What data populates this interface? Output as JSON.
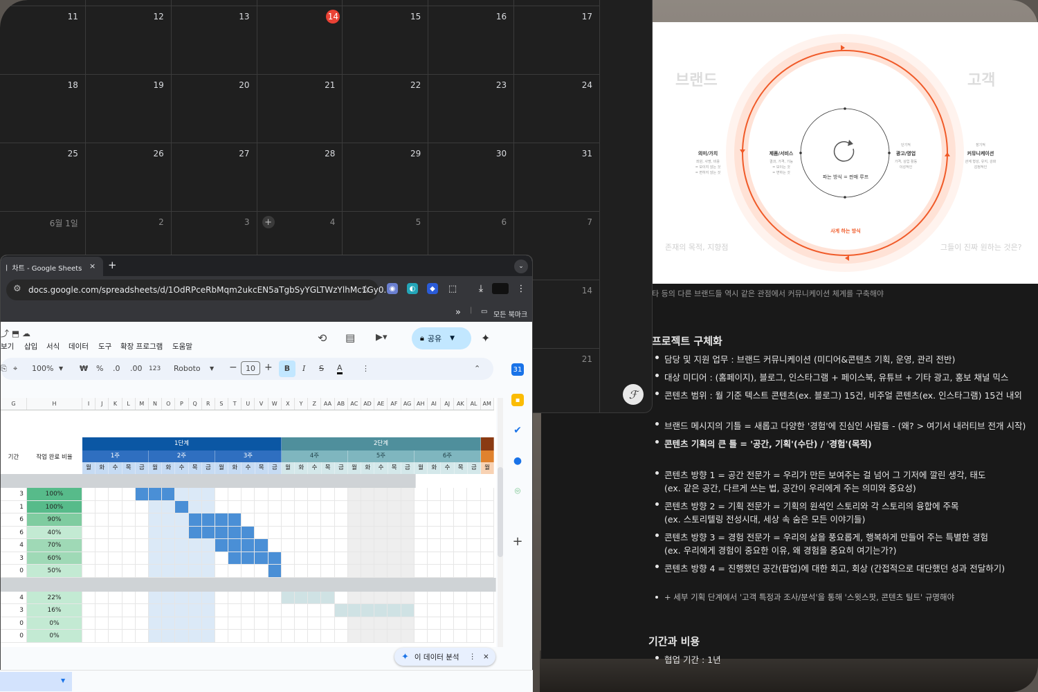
{
  "calendar": {
    "weeks": [
      [
        {
          "n": "",
          "dim": false
        },
        {
          "n": "",
          "dim": false
        },
        {
          "n": "",
          "dim": false
        },
        {
          "n": "",
          "dim": false
        },
        {
          "n": "",
          "dim": false
        },
        {
          "n": "",
          "dim": false
        },
        {
          "n": "",
          "dim": false
        }
      ],
      [
        {
          "n": "11"
        },
        {
          "n": "12"
        },
        {
          "n": "13"
        },
        {
          "n": "14",
          "today": true
        },
        {
          "n": "15"
        },
        {
          "n": "16"
        },
        {
          "n": "17"
        }
      ],
      [
        {
          "n": "18"
        },
        {
          "n": "19"
        },
        {
          "n": "20"
        },
        {
          "n": "21"
        },
        {
          "n": "22"
        },
        {
          "n": "23"
        },
        {
          "n": "24"
        }
      ],
      [
        {
          "n": "25"
        },
        {
          "n": "26"
        },
        {
          "n": "27"
        },
        {
          "n": "28"
        },
        {
          "n": "29"
        },
        {
          "n": "30"
        },
        {
          "n": "31"
        }
      ],
      [
        {
          "n": "6월 1일",
          "dim": true
        },
        {
          "n": "2",
          "dim": true
        },
        {
          "n": "3",
          "dim": true
        },
        {
          "n": "4",
          "dim": true,
          "add": true
        },
        {
          "n": "5",
          "dim": true
        },
        {
          "n": "6",
          "dim": true
        },
        {
          "n": "7",
          "dim": true
        }
      ],
      [
        {
          "n": "",
          "dim": true
        },
        {
          "n": "",
          "dim": true
        },
        {
          "n": "",
          "dim": true
        },
        {
          "n": "",
          "dim": true
        },
        {
          "n": "",
          "dim": true
        },
        {
          "n": "",
          "dim": true
        },
        {
          "n": "14",
          "dim": true
        }
      ],
      [
        {
          "n": "",
          "dim": true
        },
        {
          "n": "",
          "dim": true
        },
        {
          "n": "",
          "dim": true
        },
        {
          "n": "",
          "dim": true
        },
        {
          "n": "",
          "dim": true
        },
        {
          "n": "",
          "dim": true
        },
        {
          "n": "21",
          "dim": true
        }
      ]
    ],
    "add_symbol": "+"
  },
  "slide": {
    "brand": "브랜드",
    "customer": "고객",
    "brand_sub": "존재의 목적, 지향점",
    "customer_sub": "그들이 진짜 원하는 것은?",
    "center": "파는 방식 = 판매 루프",
    "bottom": "사게 하는 방식",
    "n1": {
      "title": "의미/가치",
      "sub": "좌원, 사명, 비용\n= 보이지 않는 것\n= 변하지 않는 것"
    },
    "n2": {
      "title": "제품/서비스",
      "sub": "결과, 가격, 기능\n= 보이는 것\n= 변하는 것"
    },
    "n3": {
      "top": "단기적",
      "title": "광고/영업",
      "sub": "가격, 상업 활동\n이성적인"
    },
    "n4": {
      "top": "장기적",
      "title": "커뮤니케이션",
      "sub": "관계 형성, 유지, 강화\n감정적인"
    },
    "accent": "#f05a28"
  },
  "doc": {
    "caption": "타 등의 다른 브랜드들 역시 같은 관점에서 커뮤니케이션 체계를 구축해야",
    "section1": "프로젝트 구체화",
    "b1": "담당 및 지원 업무 :              브랜드 커뮤니케이션 (미디어&콘텐츠 기획, 운영, 관리 전반)",
    "b2": "대상 미디어 : (홈페이지), 블로그, 인스타그램 + 페이스북, 유튜브 + 기타 광고, 홍보 채널 믹스",
    "b3": "콘텐츠 범위 : 월 기준 텍스트 콘텐츠(ex. 블로그) 15건, 비주얼 콘텐츠(ex. 인스타그램) 15건 내외",
    "b4": "브랜드 메시지의 기틀 = 새롭고 다양한 '경험'에 진심인 사람들 - (왜? > 여기서 내러티브 전개 시작)",
    "b5": "콘텐츠 기획의 큰 틀 = '공간, 기획'(수단) / '경험'(목적)",
    "b6a": "콘텐츠 방향 1 = 공간 전문가 = 우리가 만든 보여주는 걸 넘어 그 기저에 깔린 생각, 태도",
    "b6b": "(ex. 같은 공간, 다르게 쓰는 법, 공간이 우리에게 주는 의미와 중요성)",
    "b7a": "콘텐츠 방향 2 = 기획 전문가 = 기획의 원석인 스토리와 각 스토리의 융합에 주목",
    "b7b": "(ex. 스토리텔링 전성시대, 세상 속 숨은 모든 이야기들)",
    "b8a": "콘텐츠 방향 3 = 경험 전문가 = 우리의 삶을 풍요롭게, 행복하게 만들어 주는 특별한 경험",
    "b8b": "(ex. 우리에게 경험이 중요한 이유, 왜 경험을 중요히 여기는가?)",
    "b9": "콘텐츠 방향 4 = 진행했던 공간(팝업)에 대한 회고, 회상 (간접적으로 대단했던 성과 전달하기)",
    "b10": "+ 세부 기획 단계에서 '고객 특정과 조사/분석'을 통해 '스윗스팟, 콘텐츠 틸트' 규명해야",
    "section2": "기간과 비용",
    "b11": "협업 기간 : 1년"
  },
  "browser": {
    "tab_title": "ㅣ 차트 - Google Sheets",
    "close": "×",
    "newtab": "+",
    "url": "docs.google.com/spreadsheets/d/1OdRPceRbMqm2ukcEN5aTgbSyYGLTWzYlhMc1Gy0...",
    "more_bookmarks": "»",
    "all_bookmarks": "모든 북마크"
  },
  "sheets": {
    "menus": [
      "보기",
      "삽입",
      "서식",
      "데이터",
      "도구",
      "확장 프로그램",
      "도움말"
    ],
    "share": "공유",
    "zoom": "100%",
    "currency": "₩",
    "percent": "%",
    "dec_less": ".0",
    "dec_more": ".00",
    "format123": "123",
    "font": "Roboto",
    "font_size": "10",
    "bold": "B",
    "italic": "I",
    "strike": "S",
    "textcolor": "A",
    "cols": [
      "G",
      "H",
      "I",
      "J",
      "K",
      "L",
      "M",
      "N",
      "O",
      "P",
      "Q",
      "R",
      "S",
      "T",
      "U",
      "V",
      "W",
      "X",
      "Y",
      "Z",
      "AA",
      "AB",
      "AC",
      "AD",
      "AE",
      "AF",
      "AG",
      "AH",
      "AI",
      "AJ",
      "AK",
      "AL",
      "AM"
    ],
    "phase1": "1단계",
    "phase2": "2단계",
    "weeks": [
      "1주",
      "2주",
      "3주",
      "4주",
      "5주",
      "6주"
    ],
    "days": [
      "월",
      "화",
      "수",
      "목",
      "금"
    ],
    "period_hdr": "기간",
    "ratio_hdr": "작업 완료 비율",
    "rows": [
      {
        "g": "3",
        "h": "100%"
      },
      {
        "g": "1",
        "h": "100%"
      },
      {
        "g": "6",
        "h": "90%"
      },
      {
        "g": "6",
        "h": "40%"
      },
      {
        "g": "4",
        "h": "70%"
      },
      {
        "g": "3",
        "h": "60%"
      },
      {
        "g": "0",
        "h": "50%"
      },
      {
        "g": "",
        "h": ""
      },
      {
        "g": "4",
        "h": "22%"
      },
      {
        "g": "3",
        "h": "16%"
      },
      {
        "g": "0",
        "h": "0%"
      },
      {
        "g": "0",
        "h": "0%"
      }
    ],
    "analyze": "이 데이터 분석"
  }
}
